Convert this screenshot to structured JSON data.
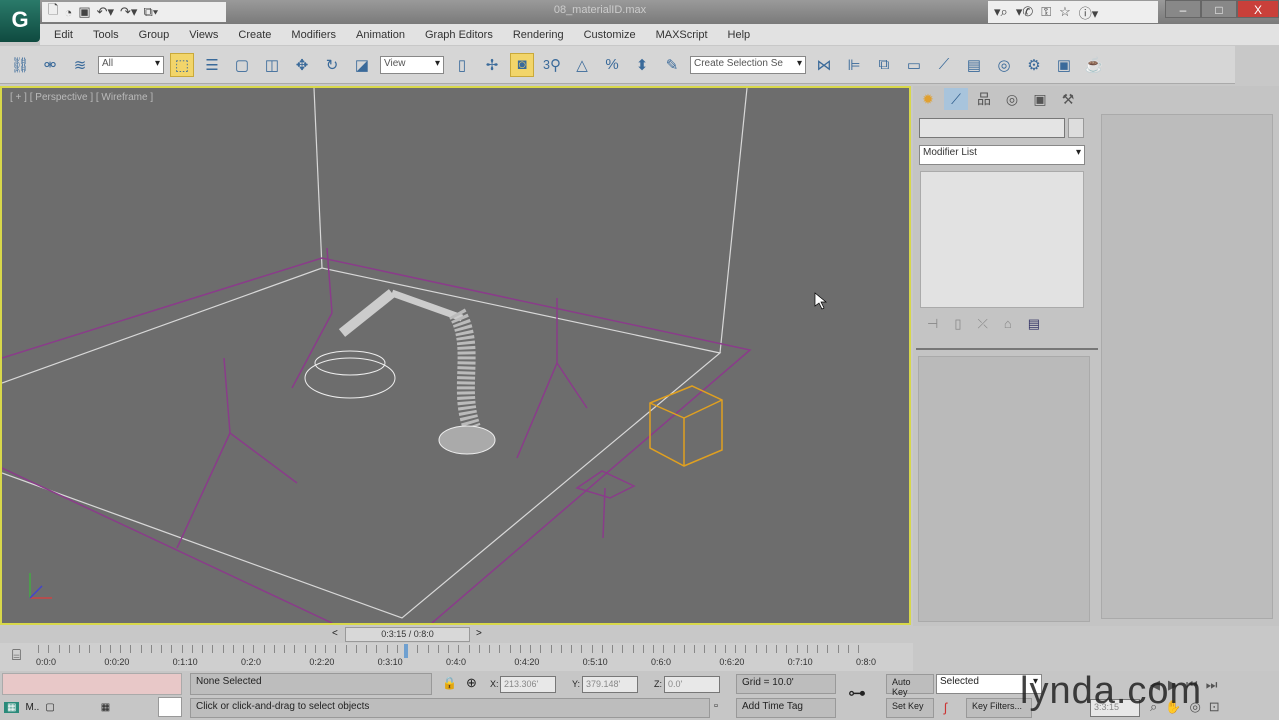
{
  "titlebar": {
    "logo": "G",
    "title": "08_materialID.max",
    "qat_icons": [
      "new-icon",
      "open-icon",
      "save-icon",
      "undo-icon",
      "redo-icon",
      "project-icon"
    ],
    "window_buttons": [
      "–",
      "□",
      "X"
    ]
  },
  "menu": [
    "Edit",
    "Tools",
    "Group",
    "Views",
    "Create",
    "Modifiers",
    "Animation",
    "Graph Editors",
    "Rendering",
    "Customize",
    "MAXScript",
    "Help"
  ],
  "toolbar": {
    "selection_filter": "All",
    "reference_coord": "View",
    "named_selection": "Create Selection Se",
    "snap_label": "3"
  },
  "viewport": {
    "label": "[ + ] [ Perspective ] [ Wireframe ]",
    "accent": "#d8d84a"
  },
  "command_panel": {
    "name_field": "",
    "modifier_list": "Modifier List"
  },
  "timeslider": {
    "current": "0:3:15 / 0:8:0",
    "prev": "<",
    "next": ">",
    "position": 0.44
  },
  "trackbar": {
    "labels": [
      "0:0:0",
      "0:0:20",
      "0:1:10",
      "0:2:0",
      "0:2:20",
      "0:3:10",
      "0:4:0",
      "0:4:20",
      "0:5:10",
      "0:6:0",
      "0:6:20",
      "0:7:10",
      "0:8:0"
    ]
  },
  "status": {
    "script_label": "M..",
    "selection": "None Selected",
    "prompt": "Click or click-and-drag to select objects",
    "x": "213.306'",
    "y": "379.148'",
    "z": "0.0'",
    "x_label": "X:",
    "y_label": "Y:",
    "z_label": "Z:",
    "grid": "Grid = 10.0'",
    "add_time_tag": "Add Time Tag",
    "auto_key": "Auto Key",
    "set_key": "Set Key",
    "key_mode": "Selected",
    "key_filters": "Key Filters...",
    "frame": "3:3:15"
  },
  "watermark": "lynda.com"
}
